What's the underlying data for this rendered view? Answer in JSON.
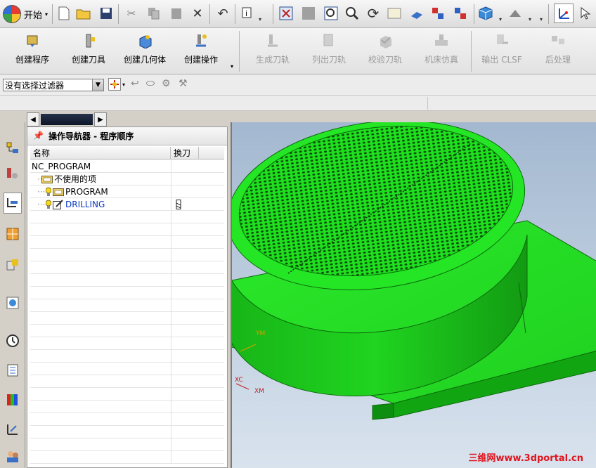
{
  "top_toolbar": {
    "start_label": "开始",
    "icons": [
      "new-icon",
      "open-icon",
      "save-icon",
      "cut-icon",
      "copy-icon",
      "paste-icon",
      "delete-icon",
      "undo-icon",
      "info-icon",
      "fit-icon",
      "zoom-area-icon",
      "zoom-icon",
      "rotate-icon",
      "pan-icon",
      "render-icon",
      "display-icon",
      "view-icon",
      "orient-icon",
      "csys-icon"
    ]
  },
  "main_toolbar": {
    "buttons": [
      {
        "label": "创建程序",
        "icon": "create-program-icon",
        "enabled": true
      },
      {
        "label": "创建刀具",
        "icon": "create-tool-icon",
        "enabled": true
      },
      {
        "label": "创建几何体",
        "icon": "create-geometry-icon",
        "enabled": true
      },
      {
        "label": "创建操作",
        "icon": "create-operation-icon",
        "enabled": true
      },
      {
        "label": "生成刀轨",
        "icon": "generate-toolpath-icon",
        "enabled": false
      },
      {
        "label": "列出刀轨",
        "icon": "list-toolpath-icon",
        "enabled": false
      },
      {
        "label": "校验刀轨",
        "icon": "verify-toolpath-icon",
        "enabled": false
      },
      {
        "label": "机床仿真",
        "icon": "machine-sim-icon",
        "enabled": false
      },
      {
        "label": "输出 CLSF",
        "icon": "output-clsf-icon",
        "enabled": false
      },
      {
        "label": "后处理",
        "icon": "postprocess-icon",
        "enabled": false
      }
    ]
  },
  "filter": {
    "selected": "没有选择过滤器"
  },
  "navigator": {
    "title": "操作导航器 - 程序顺序",
    "columns": [
      "名称",
      "换刀"
    ],
    "rows": [
      {
        "name": "NC_PROGRAM",
        "tool_change": ""
      },
      {
        "name": "不使用的项",
        "tool_change": ""
      },
      {
        "name": "PROGRAM",
        "tool_change": ""
      },
      {
        "name": "DRILLING",
        "tool_change": "tool-change-icon"
      }
    ]
  },
  "viewport": {
    "axis_labels": {
      "ym": "YM",
      "xc": "XC",
      "xm": "XM"
    },
    "watermark": "三维网www.3dportal.cn",
    "model_color": "#1fe01f",
    "background_top": "#a3b8d0",
    "background_bottom": "#d9e3ee"
  }
}
